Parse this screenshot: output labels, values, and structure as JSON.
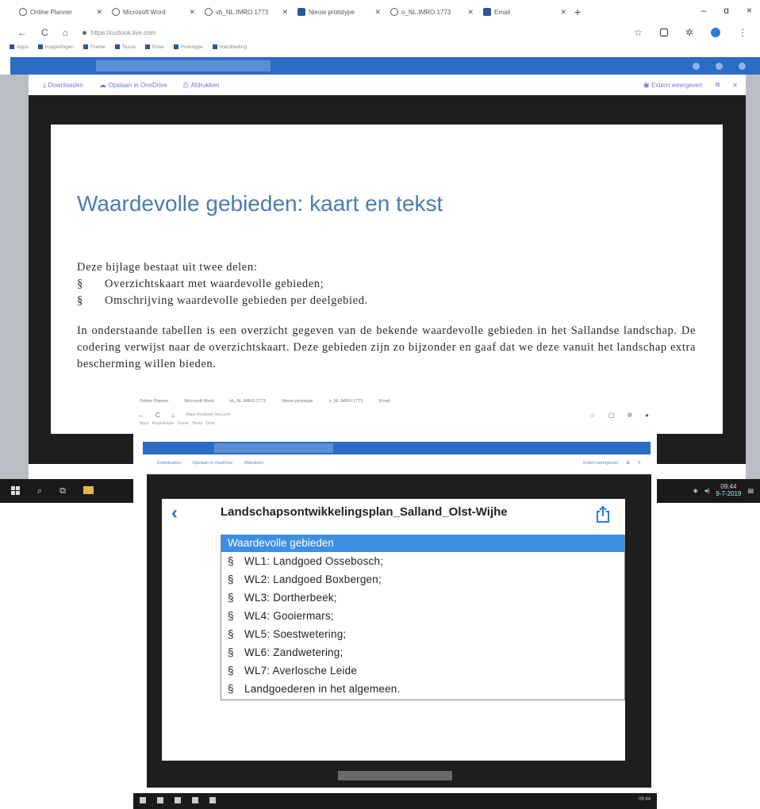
{
  "browser": {
    "tabs": [
      {
        "label": "Online Planner",
        "icon": "planner-icon"
      },
      {
        "label": "Microsoft Word",
        "icon": "chrome-icon"
      },
      {
        "label": "vb_NL.IMRO.1773",
        "icon": "chrome-icon"
      },
      {
        "label": "Nieuw prototype",
        "icon": "docs-icon"
      },
      {
        "label": "o_NL.IMRO.1773",
        "icon": "chrome-icon"
      },
      {
        "label": "Email",
        "icon": "docs-icon"
      }
    ],
    "new_tab": "+",
    "window_controls": {
      "minimize": "–",
      "maximize": "ɑ",
      "close": "×"
    },
    "address": "https://outlook.live.com",
    "bookmarks": [
      "Apps",
      "Koppelingen",
      "Frame",
      "Tessa",
      "Drive",
      "Prototype",
      "Handleiding"
    ],
    "colors": {
      "brand": "#2b6cc4",
      "title": "#4a7db0",
      "table_header": "#3d8fe0",
      "back_arrow": "#2d7de0"
    }
  },
  "viewer_toolbar": {
    "download": "Downloaden",
    "save": "Opslaan in OneDrive",
    "print": "Afdrukken",
    "open_with": "Extern weergeven"
  },
  "document": {
    "title": "Waardevolle gebieden: kaart en tekst",
    "intro": "Deze bijlage bestaat uit twee delen:",
    "bullets": [
      {
        "mark": "§",
        "text": "Overzichtskaart met waardevolle gebieden;"
      },
      {
        "mark": "§",
        "text": "Omschrijving waardevolle gebieden per deelgebied."
      }
    ],
    "paragraph": "In onderstaande tabellen is een overzicht gegeven van de bekende waardevolle gebieden in het Sallandse landschap. De codering verwijst naar de overzichtskaart. Deze gebieden zijn zo bijzonder en gaaf dat we deze vanuit het landschap extra bescherming willen bieden."
  },
  "taskbar": {
    "time": "09:44",
    "date": "9-7-2019"
  },
  "nested_screen": {
    "heading": "Landschapsontwikkelingsplan_Salland_Olst-Wijhe",
    "table_header": "Waardevolle gebieden",
    "rows": [
      {
        "mark": "§",
        "text": "WL1: Landgoed Ossebosch;"
      },
      {
        "mark": "§",
        "text": "WL2: Landgoed Boxbergen;"
      },
      {
        "mark": "§",
        "text": "WL3: Dortherbeek;"
      },
      {
        "mark": "§",
        "text": "WL4: Gooiermars;"
      },
      {
        "mark": "§",
        "text": "WL5: Soestwetering;"
      },
      {
        "mark": "§",
        "text": "WL6: Zandwetering;"
      },
      {
        "mark": "§",
        "text": "WL7: Averlosche Leide"
      },
      {
        "mark": "§",
        "text": "Landgoederen in het algemeen."
      }
    ]
  }
}
